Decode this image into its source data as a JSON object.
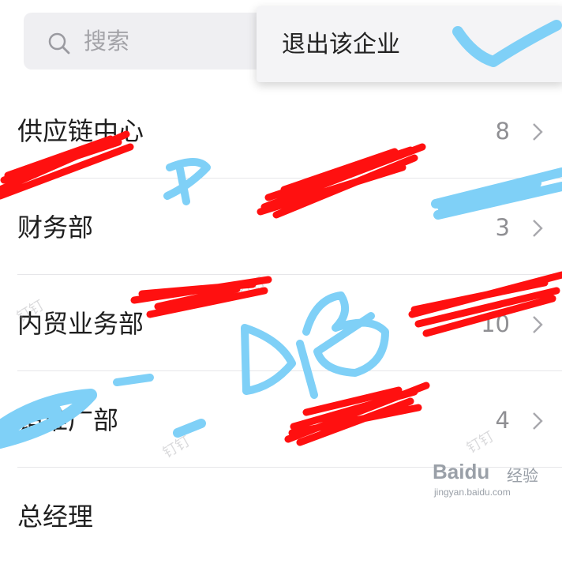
{
  "search": {
    "placeholder": "搜索"
  },
  "menu": {
    "items": [
      {
        "label": "退出该企业"
      }
    ]
  },
  "departments": [
    {
      "name": "供应链中心",
      "count": "8"
    },
    {
      "name": "财务部",
      "count": "3"
    },
    {
      "name": "内贸业务部",
      "count": "10"
    },
    {
      "name": "销推广部",
      "count": "4"
    },
    {
      "name": "总经理",
      "count": ""
    }
  ],
  "watermarks": {
    "dingding": "钉钉"
  },
  "baidu": {
    "brand": "Bai",
    "brand2": "du",
    "cn": "经验",
    "url": "jingyan.baidu.com"
  },
  "colors": {
    "red_scribble": "#ff0000",
    "blue_scribble": "#7fd0f7",
    "text_primary": "#1f1f1f",
    "text_secondary": "#8f8f93"
  },
  "icons": {
    "search": "search-icon",
    "chevron": "chevron-right-icon"
  }
}
